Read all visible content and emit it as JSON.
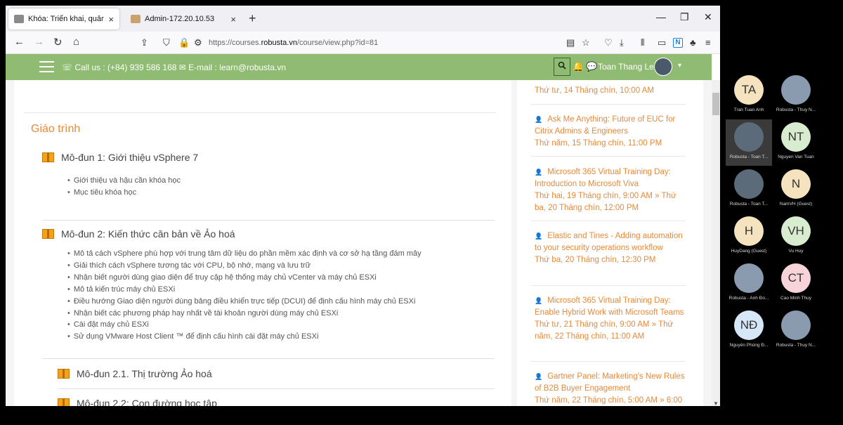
{
  "browser": {
    "tabs": [
      {
        "title": "Khóa: Triển khai, quản trị hạ tầng",
        "close": "×"
      },
      {
        "title": "Admin-172.20.10.53",
        "close": "×"
      }
    ],
    "new_tab": "+",
    "window_controls": {
      "minimize": "—",
      "maximize": "❐",
      "close": "✕"
    },
    "nav": {
      "back": "←",
      "forward": "→",
      "reload": "↻",
      "home": "⌂"
    },
    "url_prefix": "https://courses.",
    "url_host": "robusta.vn",
    "url_path": "/course/view.php?id=81"
  },
  "site_header": {
    "contact": "☏ Call us : (+84) 939 586 168  ✉ E-mail : learn@robusta.vn",
    "search_icon": "search-icon",
    "user_name": "Toan Thang Le",
    "caret": "▾"
  },
  "course": {
    "section_title": "Giáo trình",
    "modules": [
      {
        "title": "Mô-đun 1: Giới thiệu vSphere 7",
        "items": [
          "Giới thiệu và hậu cần khóa học",
          "Mục tiêu khóa học"
        ]
      },
      {
        "title": "Mô-đun 2: Kiến thức căn bản về Ảo hoá",
        "items": [
          "Mô tả cách vSphere phù hợp với trung tâm dữ liệu do phần mềm xác định và cơ sở hạ tầng đám mây",
          "Giải thích cách vSphere tương tác với CPU, bộ nhớ, mạng và lưu trữ",
          "Nhận biết người dùng giao diện để truy cập hệ thống máy chủ vCenter và máy chủ ESXi",
          "Mô tả kiến trúc máy chủ ESXi",
          "Điều hướng Giao diện người dùng bảng điều khiển trực tiếp (DCUI) để định cấu hình máy chủ ESXi",
          "Nhận biết các phương pháp hay nhất về tài khoản người dùng máy chủ ESXi",
          "Cài đặt máy chủ ESXi",
          "Sử dụng VMware Host Client ™ để định cấu hình cài đặt máy chủ ESXi"
        ]
      },
      {
        "title": "Mô-đun 2.1. Thị trường Ảo hoá",
        "items": []
      },
      {
        "title": "Mô-đun 2.2: Con đường học tập",
        "items": []
      }
    ]
  },
  "events": [
    {
      "title": "",
      "time": "Thứ tư, 14 Tháng chín, 10:00 AM"
    },
    {
      "title": "Ask Me Anything: Future of EUC for Citrix Admins & Engineers",
      "time": "Thứ năm, 15 Tháng chín, 11:00 PM"
    },
    {
      "title": "Microsoft 365 Virtual Training Day: Introduction to Microsoft Viva",
      "time": "Thứ hai, 19 Tháng chín, 9:00 AM » Thứ ba, 20 Tháng chín, 12:00 PM"
    },
    {
      "title": "Elastic and Tines - Adding automation to your security operations workflow",
      "time": "Thứ ba, 20 Tháng chín, 12:30 PM"
    },
    {
      "title": "Microsoft 365 Virtual Training Day: Enable Hybrid Work with Microsoft Teams",
      "time": "Thứ tư, 21 Tháng chín, 9:00 AM » Thứ năm, 22 Tháng chín, 11:00 AM"
    },
    {
      "title": "Gartner Panel: Marketing's New Rules of B2B Buyer Engagement",
      "time": "Thứ năm, 22 Tháng chín, 5:00 AM » 6:00"
    }
  ],
  "participants": [
    {
      "initials": "TA",
      "name": "Tran Tuan Anh",
      "color": "#f5e3bf"
    },
    {
      "initials": "",
      "name": "Robusta - Thuy N...",
      "color": "#8a9bb0"
    },
    {
      "initials": "",
      "name": "Robusta - Toan T...",
      "color": "#5c6b7a"
    },
    {
      "initials": "NT",
      "name": "Nguyen Van Tuan",
      "color": "#d8ecd0"
    },
    {
      "initials": "",
      "name": "Robusta - Toan T...",
      "color": "#5c6b7a"
    },
    {
      "initials": "N",
      "name": "NamVH (Guest)",
      "color": "#f5e3bf"
    },
    {
      "initials": "H",
      "name": "HuyDang (Guest)",
      "color": "#f5e3bf"
    },
    {
      "initials": "VH",
      "name": "Vu Huy",
      "color": "#d8ecd0"
    },
    {
      "initials": "",
      "name": "Robusta - Anh Đo...",
      "color": "#8a9bb0"
    },
    {
      "initials": "CT",
      "name": "Cao Minh Thuy",
      "color": "#f8d4da"
    },
    {
      "initials": "NĐ",
      "name": "Nguyễn Phùng Đ...",
      "color": "#d6e8f7"
    },
    {
      "initials": "",
      "name": "Robusta - Thuy N...",
      "color": "#8a9bb0"
    }
  ],
  "colors": {
    "accent_orange": "#e48a3c",
    "header_green": "#8fbc72"
  }
}
